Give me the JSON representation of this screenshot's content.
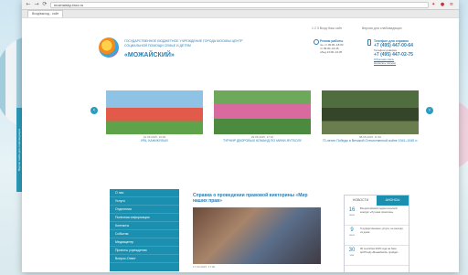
{
  "browser": {
    "back": "←",
    "forward": "→",
    "reload": "⟳",
    "url": "mozhaisky-faxc.ru",
    "tools": "✦ ● ≡",
    "tab_title": "Вход/выход - сайт"
  },
  "side_tab": "Версия сайта для слабовидящих",
  "header": {
    "org_text": "Государственное бюджетное учреждение города Москвы Центр социальной помощи семье и детям",
    "org_name": "«МОЖАЙСКИЙ»",
    "lang": "1 2 3 Вход Наш сайт",
    "vision": "Версия для слабовидящих",
    "hours_title": "Режим работы",
    "hours_lines": [
      "пн–чт 09:00–18:00",
      "пт 09:00–16:45",
      "обед 13:00–13:45"
    ],
    "phones_title": "Телефон для справок",
    "phone1": "+7 (495) 447-00-64",
    "phone_label": "Телефон доверия",
    "phone2": "+7 (495) 447-02-75",
    "link1": "Обратная связь",
    "link2": "Написать письмо"
  },
  "slider": {
    "prev": "‹",
    "next": "›",
    "slides": [
      {
        "date": "01.06.2015, 16:26",
        "title": "УРА, КАНИКУЛЫ!!!"
      },
      {
        "date": "29.05.2015, 17:10",
        "title": "ТУРНИР ДВОРОВЫХ КОМАНД ПО МИНИ-ФУТБОЛУ"
      },
      {
        "date": "08.05.2015, 11:30",
        "title": "70-летие Победы в Великой Отечественной войне 1941–1945 гг."
      }
    ]
  },
  "menu": [
    "О нас",
    "Услуги",
    "Отделения",
    "Полезная информация",
    "Контакты",
    "События",
    "Медиацентр",
    "Проекты учреждения",
    "Вопрос-Ответ"
  ],
  "article": {
    "title": "Справка о проведении правовой викторины «Мир наших прав»",
    "date": "17.03.2015, 17:00"
  },
  "newsbox": {
    "tab1": "НОВОСТИ",
    "tab2": "АНОНСЫ",
    "items": [
      {
        "day": "16",
        "mon": "июня",
        "text": "Всероссийский педагогический конкурс «Лучшая практика»"
      },
      {
        "day": "9",
        "mon": "июня",
        "text": "Государственные услуги, не выходя из дома"
      },
      {
        "day": "30",
        "mon": "мая",
        "text": "30 сентября 2015 года на базе ЦСПСиД «Можайский» пройдёт..."
      }
    ]
  },
  "colors": {
    "accent": "#2a7fb4",
    "menu": "#1b8fb0"
  }
}
